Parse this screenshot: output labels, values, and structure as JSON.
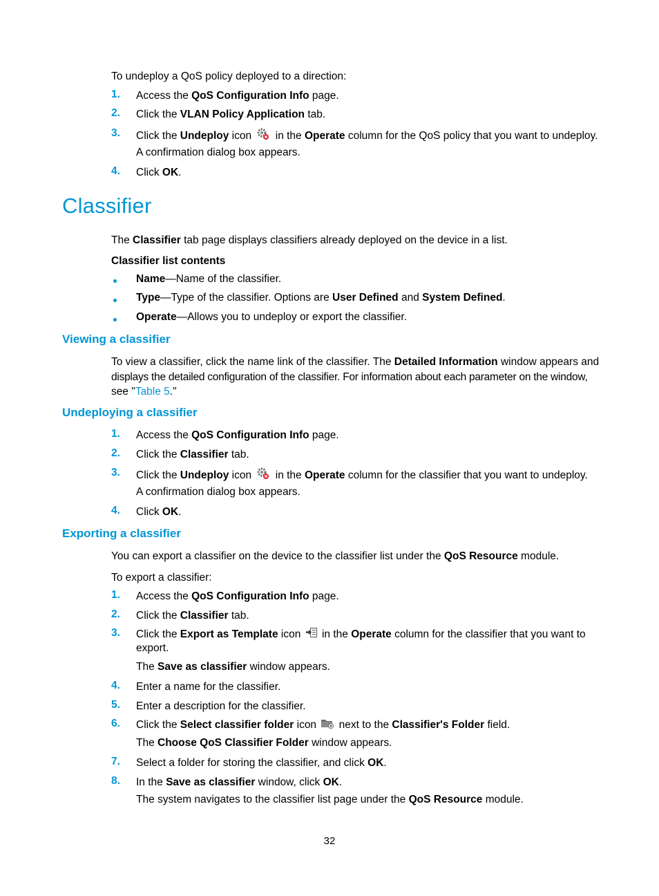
{
  "intro_undeploy_policy": {
    "lead": "To undeploy a QoS policy deployed to a direction:",
    "steps": [
      {
        "num": "1.",
        "parts": [
          "Access the ",
          "QoS Configuration Info",
          " page."
        ]
      },
      {
        "num": "2.",
        "parts": [
          "Click the ",
          "VLAN Policy Application",
          " tab."
        ]
      },
      {
        "num": "3.",
        "parts": [
          "Click the ",
          "Undeploy",
          " icon",
          " in the ",
          "Operate",
          " column for the QoS policy that you want to undeploy."
        ],
        "note": "A confirmation dialog box appears."
      },
      {
        "num": "4.",
        "parts": [
          "Click ",
          "OK",
          "."
        ]
      }
    ]
  },
  "section": {
    "title": "Classifier",
    "intro": [
      "The ",
      "Classifier",
      " tab page displays classifiers already deployed on the device in a list."
    ],
    "list_heading": "Classifier list contents",
    "bullets": [
      {
        "term": "Name",
        "desc": "—Name of the classifier."
      },
      {
        "term": "Type",
        "desc": "—Type of the classifier. Options are ",
        "opt1": "User Defined",
        "and": " and ",
        "opt2": "System Defined",
        "end": "."
      },
      {
        "term": "Operate",
        "desc": "—Allows you to undeploy or export the classifier."
      }
    ]
  },
  "viewing": {
    "heading": "Viewing a classifier",
    "line1": [
      "To view a classifier, click the name link of the classifier. The ",
      "Detailed Information",
      " window appears and"
    ],
    "line2": "displays the detailed configuration of the classifier. For information about each parameter on the window,",
    "line3_pre": "see \"",
    "line3_link": "Table 5",
    "line3_post": ".\""
  },
  "undeploying": {
    "heading": "Undeploying a classifier",
    "steps": [
      {
        "num": "1.",
        "parts": [
          "Access the ",
          "QoS Configuration Info",
          " page."
        ]
      },
      {
        "num": "2.",
        "parts": [
          "Click the ",
          "Classifier",
          " tab."
        ]
      },
      {
        "num": "3.",
        "parts": [
          "Click the ",
          "Undeploy",
          " icon",
          " in the ",
          "Operate",
          " column for the classifier that you want to undeploy."
        ],
        "note": "A confirmation dialog box appears."
      },
      {
        "num": "4.",
        "parts": [
          "Click ",
          "OK",
          "."
        ]
      }
    ]
  },
  "exporting": {
    "heading": "Exporting a classifier",
    "intro": [
      "You can export a classifier on the device to the classifier list under the ",
      "QoS Resource",
      " module."
    ],
    "lead": "To export a classifier:",
    "steps": [
      {
        "num": "1.",
        "parts": [
          "Access the ",
          "QoS Configuration Info",
          " page."
        ]
      },
      {
        "num": "2.",
        "parts": [
          "Click the ",
          "Classifier",
          " tab."
        ]
      },
      {
        "num": "3.",
        "parts": [
          "Click the ",
          "Export as Template",
          " icon",
          " in the ",
          "Operate",
          " column for the classifier that you want to"
        ],
        "cont": "export.",
        "note": [
          "The ",
          "Save as classifier",
          " window appears."
        ]
      },
      {
        "num": "4.",
        "text": "Enter a name for the classifier."
      },
      {
        "num": "5.",
        "text": "Enter a description for the classifier."
      },
      {
        "num": "6.",
        "parts": [
          "Click the ",
          "Select classifier folder",
          " icon",
          " next to the ",
          "Classifier's Folder",
          " field."
        ],
        "note": [
          "The ",
          "Choose QoS Classifier Folder",
          " window appears."
        ]
      },
      {
        "num": "7.",
        "parts": [
          "Select a folder for storing the classifier, and click ",
          "OK",
          "."
        ]
      },
      {
        "num": "8.",
        "parts": [
          "In the ",
          "Save as classifier",
          " window, click ",
          "OK",
          "."
        ],
        "note": [
          "The system navigates to the classifier list page under the ",
          "QoS Resource",
          " module."
        ]
      }
    ]
  },
  "footer": {
    "page_number": "32"
  },
  "colors": {
    "accent": "#0096d6",
    "text": "#000000"
  }
}
